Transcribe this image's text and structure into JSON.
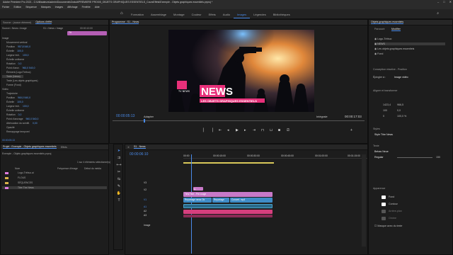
{
  "titlebar": {
    "title": "Adobe Premiere Pro 2021 - C:\\Utilisateurs\\admin\\Documents\\Gratuit\\PREMIERE PRO\\05_OBJETS GRAPHIQUES ESSENTIELS_CoursEffets\\Exemple - Objets graphiques essentiels.prproj *"
  },
  "menu": [
    "Fichier",
    "Edition",
    "Séquence",
    "Marques",
    "Images",
    "Affichage",
    "Fenêtre",
    "Aide"
  ],
  "workspaces": {
    "items": [
      "Formation",
      "Assemblage",
      "Montage",
      "Couleur",
      "Effets",
      "Audio",
      "Images",
      "Légendes",
      "Bibliothèques"
    ],
    "active": "Images"
  },
  "effects_panel": {
    "tabs": [
      "Source : (aucun élément)",
      "Options d'effet",
      "Mixage de l'élément audio : News",
      "Métadonnées"
    ],
    "source": "Source • News • Image",
    "seq": "S1 • News • Image",
    "clip_time": "00:00:10:00",
    "rows": [
      {
        "label": "Image",
        "val": ""
      },
      {
        "label": "Mouvement vertical",
        "val": ""
      },
      {
        "label": "Position",
        "val": "957,8   540,0"
      },
      {
        "label": "Échelle",
        "val": "100,0"
      },
      {
        "label": "Largeur éch.",
        "val": "100,0"
      },
      {
        "label": "Échelle uniforme",
        "val": ""
      },
      {
        "label": "Rotation",
        "val": "0,0"
      },
      {
        "label": "Point d'ancr.",
        "val": "960,0   540,0"
      },
      {
        "label": "Élément (Logo/Trébuc)",
        "val": ""
      },
      {
        "label": "Texte (News)",
        "val": ""
      },
      {
        "label": "Texte (Les objets graphiques)",
        "val": ""
      },
      {
        "label": "Forme (Fond)",
        "val": ""
      },
      {
        "label": "Vidéo",
        "val": ""
      },
      {
        "label": "Trajectoire",
        "val": ""
      },
      {
        "label": "Position",
        "val": "960,0   540,0"
      },
      {
        "label": "Échelle",
        "val": "100,0"
      },
      {
        "label": "Largeur éch.",
        "val": "100,0"
      },
      {
        "label": "Échelle uniforme",
        "val": ""
      },
      {
        "label": "Rotation",
        "val": "0,0"
      },
      {
        "label": "Point d'ancrage",
        "val": "960,0   540,0"
      },
      {
        "label": "Atténuation du scintill.",
        "val": "0,00"
      },
      {
        "label": "Opacité",
        "val": ""
      },
      {
        "label": "Remappage temporel",
        "val": ""
      }
    ],
    "bottom_time": "00:00:05:13"
  },
  "program": {
    "title": "Programme : S1 - News",
    "timecode": "00:00:05:13",
    "fit": "Adapter",
    "quality": "Intégrale",
    "duration": "00:00:17:03",
    "news_text": "NEWS",
    "sub_text": "LES OBJETS GRAPHIQUES ESSENTIELS",
    "logo_text": "TV NEWS"
  },
  "project": {
    "tabs": [
      "Projet : Exemple - Objets graphiques essentiels",
      "Effets"
    ],
    "path": "Exemple - Objets graphiques essentiels.prproj",
    "selection": "1 sur 4 éléments sélectionné(s)",
    "headers": [
      "Nom",
      "Fréquence d'image",
      "Début du média"
    ],
    "items": [
      "Logo-Trébuc.ai",
      "FLOUS",
      "SÉQUENCES",
      "Titre The News"
    ]
  },
  "timeline": {
    "tab": "S1 - News",
    "timecode": "00:00:06:10",
    "ruler": [
      "00:00",
      "00:00:15:00",
      "00:00:30:00",
      "00:00:45:00",
      "00:01:00:00",
      "00:01:15:00"
    ],
    "tracks": [
      "V3",
      "V2",
      "V1",
      "A1",
      "A2",
      "A3",
      "Image"
    ],
    "clips": {
      "v3": "fx",
      "v2": "Tirts Titre - Pré-rouge",
      "v1a": "Reportage news Ok",
      "v1b": "Reportage",
      "v1c": "Concert. mp4",
      "a1": "",
      "a2": ""
    }
  },
  "essential_graphics": {
    "tabs": [
      "Parcourir",
      "Modifier"
    ],
    "active_tab": "Modifier",
    "title": "Objets graphiques essentiels",
    "layers": [
      "Logo-Trébuc",
      "NEWS",
      "Les objets graphiques essentiels",
      "Fond"
    ],
    "responsive_label": "Conception réactive - Position",
    "pin_label": "Épingler à :",
    "pin_val": "Image vidéo",
    "align_label": "Aligner et transformer",
    "transform": [
      "1423,4",
      "966,5",
      "100",
      "0,0",
      "0",
      "100,0 %"
    ],
    "style_label": "Styles",
    "style_val": "Style Titre News",
    "text_label": "Texte",
    "font": "Bebas Neue",
    "font_style": "Regular",
    "font_size": "150",
    "appearance_label": "Apparence",
    "fill": "Fond",
    "stroke": "Contour",
    "bg": "Arrière-plan",
    "shadow": "Ombre",
    "mask": "Masque avec du texte"
  },
  "colors": {
    "accent": "#4a8bea",
    "pink": "#e0397d",
    "magenta_clip": "#c879c8",
    "audio_clip": "#3f8cc7",
    "news_bg": "#e8307a"
  }
}
